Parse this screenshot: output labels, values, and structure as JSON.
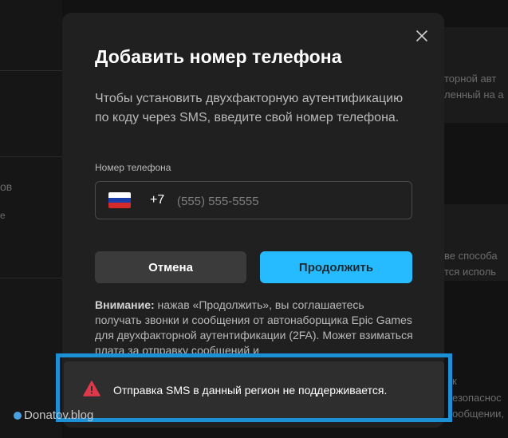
{
  "background": {
    "left_fragments": [
      "ов",
      "е"
    ],
    "right_fragments": [
      "торной авт",
      "ленный на а",
      "ве способа",
      "тся исполь",
      "к",
      "езопаснос",
      "ообщении,"
    ]
  },
  "modal": {
    "title": "Добавить номер телефона",
    "description": "Чтобы установить двухфакторную аутентификацию по коду через SMS, введите свой номер телефона.",
    "phone_label": "Номер телефона",
    "country_flag": "russia-flag-icon",
    "country_code": "+7",
    "phone_placeholder": "(555) 555-5555",
    "phone_value": "",
    "cancel_label": "Отмена",
    "continue_label": "Продолжить",
    "notice_bold": "Внимание:",
    "notice_text": " нажав «Продолжить», вы соглашаетесь получать звонки и сообщения от автонаборщика Epic Games для двухфакторной аутентификации (2FA). Может взиматься плата за отправку сообщений и"
  },
  "toast": {
    "icon": "warning-icon",
    "message": "Отправка SMS в данный регион не поддерживается.",
    "icon_color": "#e0384b",
    "highlight_color": "#1c90d6"
  },
  "watermark": "Donatov.blog",
  "colors": {
    "accent": "#26bbff",
    "modal_bg": "#202020"
  }
}
